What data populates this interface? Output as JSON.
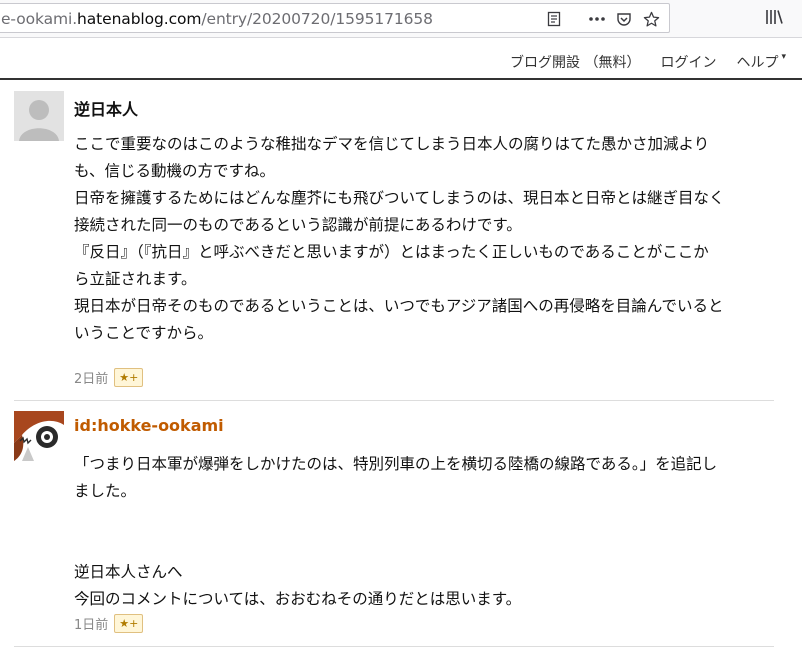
{
  "browser": {
    "url_prefix": "e-ookami.",
    "url_host": "hatenablog.com",
    "url_path": "/entry/20200720/1595171658",
    "icons": [
      "reader-view-icon",
      "more-actions-icon",
      "pocket-icon",
      "bookmark-star-icon",
      "library-icon"
    ]
  },
  "header": {
    "nav": [
      {
        "label": "ブログ開設 （無料）"
      },
      {
        "label": "ログイン"
      },
      {
        "label": "ヘルプ",
        "caret": "▾"
      }
    ]
  },
  "comments": [
    {
      "author": "逆日本人",
      "author_is_link": false,
      "lines": [
        "ここで重要なのはこのような稚拙なデマを信じてしまう日本人の腐りはてた愚かさ加減より",
        "も、信じる動機の方ですね。",
        "日帝を擁護するためにはどんな塵芥にも飛びついてしまうのは、現日本と日帝とは継ぎ目なく",
        "接続された同一のものであるという認識が前提にあるわけです。",
        "『反日』（『抗日』と呼ぶべきだと思いますが）とはまったく正しいものであることがここか",
        "ら立証されます。",
        "現日本が日帝そのものであるということは、いつでもアジア諸国への再侵略を目論んでいると",
        "いうことですから。"
      ],
      "time": "2日前",
      "star_label": "★+"
    },
    {
      "author": "id:hokke-ookami",
      "author_is_link": true,
      "lines": [
        "「つまり日本軍が爆弾をしかけたのは、特別列車の上を横切る陸橋の線路である。」を追記し",
        "ました。",
        "",
        "",
        "逆日本人さんへ",
        "今回のコメントについては、おおむねその通りだとは思います。"
      ],
      "time": "1日前",
      "star_label": "★+"
    }
  ],
  "colors": {
    "link": "#c05b00",
    "muted": "#888888",
    "header_rule": "#333333"
  }
}
